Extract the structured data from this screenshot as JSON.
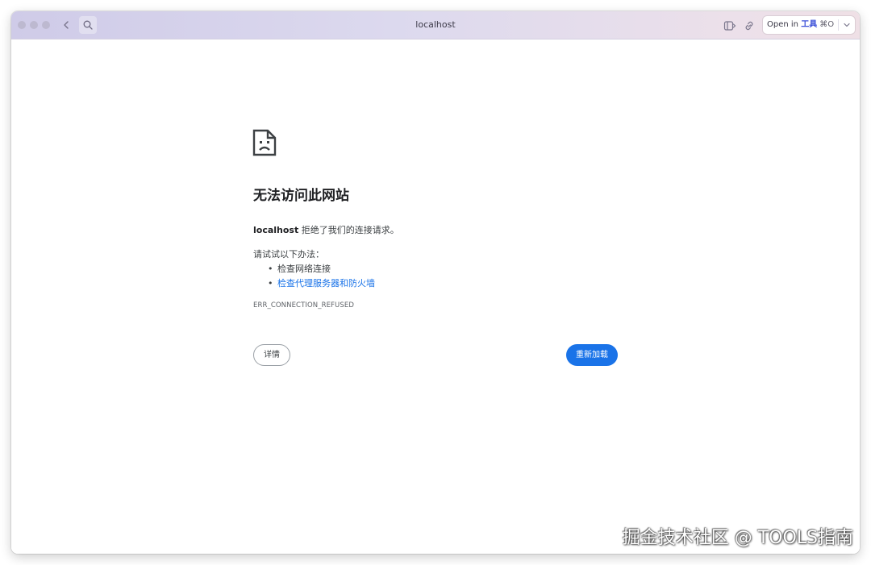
{
  "browser": {
    "url": "localhost",
    "open_in": {
      "prefix": "Open in",
      "app": "工具",
      "shortcut": "⌘O"
    }
  },
  "error_page": {
    "title": "无法访问此网站",
    "host": "localhost",
    "message": "拒绝了我们的连接请求。",
    "try_heading": "请试试以下办法：",
    "suggestions": [
      {
        "text": "检查网络连接",
        "is_link": false
      },
      {
        "text": "检查代理服务器和防火墙",
        "is_link": true
      }
    ],
    "error_code": "ERR_CONNECTION_REFUSED",
    "details_label": "详情",
    "reload_label": "重新加载"
  },
  "watermark": "掘金技术社区 @ TOOLS指南",
  "colors": {
    "accent": "#1a73e8",
    "link": "#1a73e8",
    "open_in_app": "#3b4fd8"
  },
  "icons": [
    "search-icon",
    "back-chevron-icon",
    "sidebar-toggle-icon",
    "link-icon",
    "chevron-down-icon",
    "sad-page-icon"
  ]
}
